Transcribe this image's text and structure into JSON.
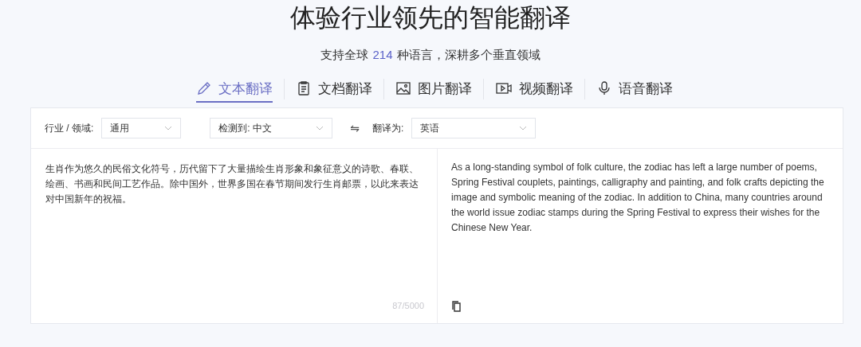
{
  "title": "体验行业领先的智能翻译",
  "subtitle": {
    "before": "支持全球",
    "count": "214",
    "after": "种语言，深耕多个垂直领域"
  },
  "tabs": [
    {
      "kind": "text",
      "label": "文本翻译",
      "selected": true
    },
    {
      "kind": "document",
      "label": "文档翻译",
      "selected": false
    },
    {
      "kind": "image",
      "label": "图片翻译",
      "selected": false
    },
    {
      "kind": "video",
      "label": "视频翻译",
      "selected": false
    },
    {
      "kind": "voice",
      "label": "语音翻译",
      "selected": false
    }
  ],
  "toolbar": {
    "domain_label": "行业 / 领域:",
    "domain_value": "通用",
    "source_value": "检测到: 中文",
    "swap": "⇋",
    "target_label": "翻译为:",
    "target_value": "英语"
  },
  "source": {
    "text": "生肖作为悠久的民俗文化符号，历代留下了大量描绘生肖形象和象征意义的诗歌、春联、绘画、书画和民间工艺作品。除中国外，世界多国在春节期间发行生肖邮票，以此来表达对中国新年的祝福。",
    "counter": "87/5000"
  },
  "target": {
    "text": "As a long-standing symbol of folk culture, the zodiac has left a large number of poems, Spring Festival couplets, paintings, calligraphy and painting, and folk crafts depicting the image and symbolic meaning of the zodiac. In addition to China, many countries around the world issue zodiac stamps during the Spring Festival to express their wishes for the Chinese New Year."
  }
}
